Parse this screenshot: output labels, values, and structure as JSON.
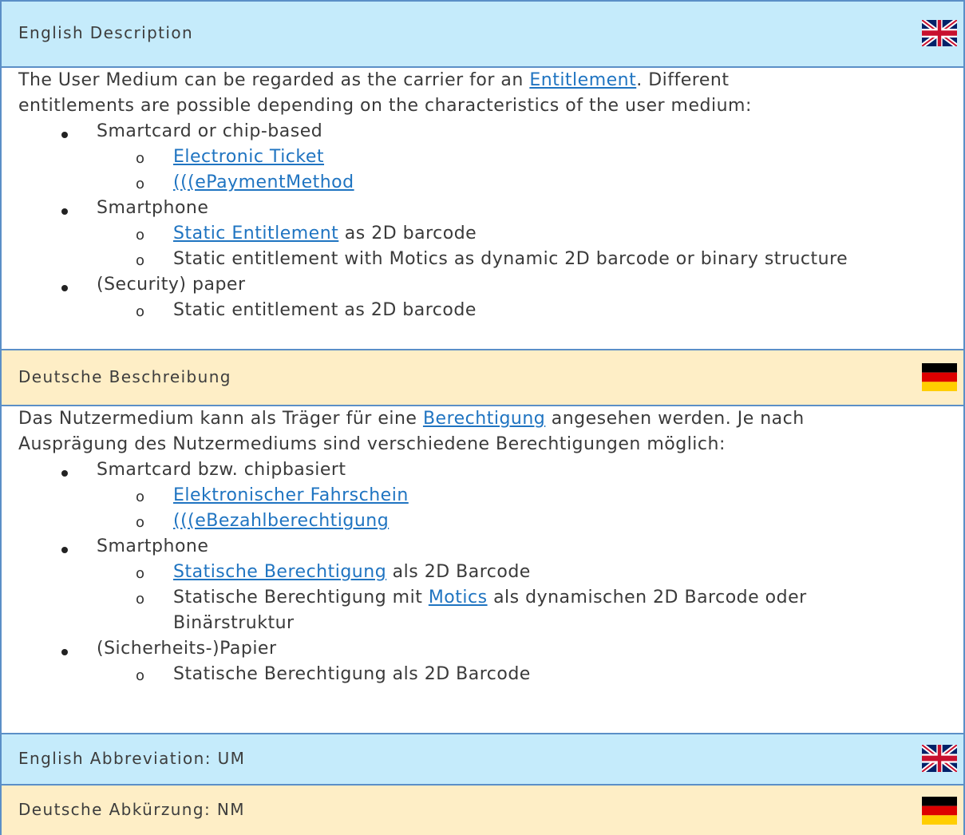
{
  "english_description": {
    "header": "English Description",
    "intro_1_pre": "The User Medium can be regarded as the carrier for an ",
    "intro_1_link": "Entitlement",
    "intro_1_post": ". Different",
    "intro_2": "entitlements are possible depending on the characteristics of the user medium:",
    "bullets": [
      {
        "label": "Smartcard or chip-based",
        "subs": [
          {
            "link": "Electronic Ticket",
            "text": ""
          },
          {
            "link": "(((ePaymentMethod",
            "text": ""
          }
        ]
      },
      {
        "label": "Smartphone",
        "subs": [
          {
            "link": "Static Entitlement",
            "text": " as 2D barcode"
          },
          {
            "link": "",
            "text": "Static entitlement with Motics as dynamic 2D barcode or binary structure"
          }
        ]
      },
      {
        "label": "(Security) paper",
        "subs": [
          {
            "link": "",
            "text": "Static entitlement as 2D barcode"
          }
        ]
      }
    ]
  },
  "deutsche_beschreibung": {
    "header": "Deutsche Beschreibung",
    "intro_1_pre": "Das Nutzermedium kann als Träger für eine ",
    "intro_1_link": "Berechtigung",
    "intro_1_post": " angesehen werden. Je nach",
    "intro_2": "Ausprägung des Nutzermediums sind verschiedene Berechtigungen möglich:",
    "bullets": [
      {
        "label": "Smartcard bzw. chipbasiert",
        "subs": [
          {
            "link": "Elektronischer Fahrschein",
            "text": ""
          },
          {
            "link": "(((eBezahlberechtigung",
            "text": ""
          }
        ]
      },
      {
        "label": "Smartphone",
        "subs": [
          {
            "link": "Statische Berechtigung",
            "text": " als 2D Barcode"
          },
          {
            "pre": "Statische Berechtigung mit ",
            "link": "Motics",
            "text": " als dynamischen 2D Barcode oder",
            "cont": "Binärstruktur"
          }
        ]
      },
      {
        "label": "(Sicherheits-)Papier",
        "subs": [
          {
            "link": "",
            "text": "Statische Berechtigung als 2D Barcode"
          }
        ]
      }
    ]
  },
  "abbreviation_en": {
    "header": "English Abbreviation: UM"
  },
  "abbreviation_de": {
    "header": "Deutsche Abkürzung: NM"
  },
  "sub_marker": "o",
  "icons": {
    "uk_flag": "uk-flag-icon",
    "de_flag": "germany-flag-icon"
  },
  "colors": {
    "border": "#5b8fc7",
    "en_header_bg": "#c5ebfb",
    "de_header_bg": "#feeec6",
    "link": "#1f74c1"
  }
}
